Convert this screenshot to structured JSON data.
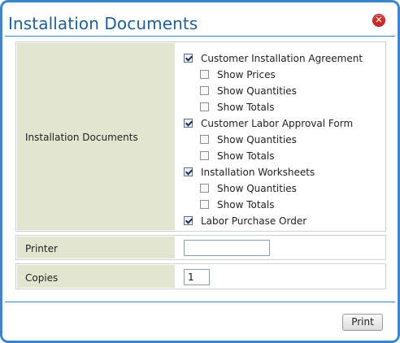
{
  "dialog": {
    "title": "Installation Documents",
    "close_icon": "close-icon",
    "accent_color": "#3a86c8",
    "title_color": "#1f5f95",
    "label_bg_color": "#e2e6d0"
  },
  "documents": {
    "label": "Installation Documents",
    "options": [
      {
        "label": "Customer Installation Agreement",
        "checked": true
      },
      {
        "label": "Show Prices",
        "checked": false
      },
      {
        "label": "Show Quantities",
        "checked": false
      },
      {
        "label": "Show Totals",
        "checked": false
      },
      {
        "label": "Customer Labor Approval Form",
        "checked": true
      },
      {
        "label": "Show Quantities",
        "checked": false
      },
      {
        "label": "Show Totals",
        "checked": false
      },
      {
        "label": "Installation Worksheets",
        "checked": true
      },
      {
        "label": "Show Quantities",
        "checked": false
      },
      {
        "label": "Show Totals",
        "checked": false
      },
      {
        "label": "Labor Purchase Order",
        "checked": true
      }
    ]
  },
  "printer": {
    "label": "Printer",
    "value": ""
  },
  "copies": {
    "label": "Copies",
    "value": "1"
  },
  "footer": {
    "print_label": "Print"
  }
}
